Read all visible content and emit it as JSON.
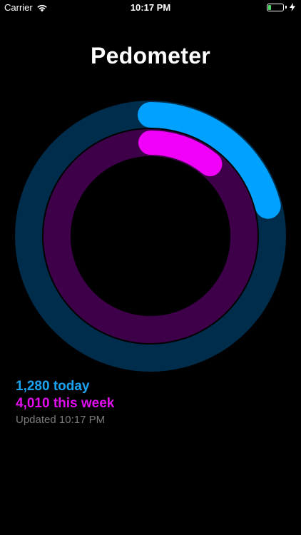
{
  "status_bar": {
    "carrier": "Carrier",
    "time": "10:17 PM",
    "battery_level": 0.2
  },
  "page": {
    "title": "Pedometer"
  },
  "rings": {
    "outer": {
      "progress": 0.21,
      "color": "#00a1ff",
      "track_color": "#002d4b"
    },
    "inner": {
      "progress": 0.11,
      "color": "#f000f8",
      "track_color": "#3e0048"
    }
  },
  "stats": {
    "today": "1,280 today",
    "week": "4,010 this week",
    "updated": "Updated 10:17 PM"
  }
}
